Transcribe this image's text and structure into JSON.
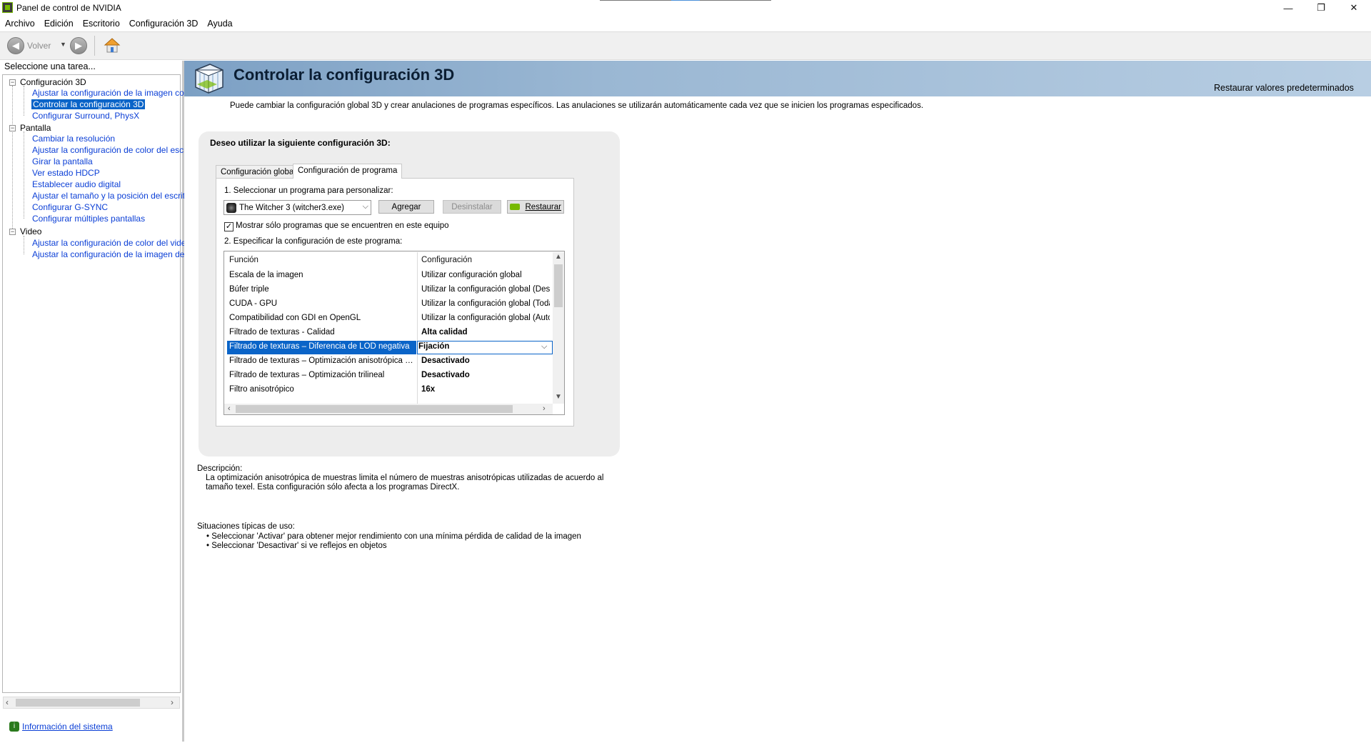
{
  "window": {
    "title": "Panel de control de NVIDIA",
    "controls": {
      "minimize": "—",
      "maximize": "❐",
      "close": "✕"
    }
  },
  "menu": [
    "Archivo",
    "Edición",
    "Escritorio",
    "Configuración 3D",
    "Ayuda"
  ],
  "toolbar": {
    "back_label": "Volver",
    "back_icon": "back-arrow-icon",
    "forward_icon": "forward-arrow-icon",
    "home_icon": "home-icon"
  },
  "sidebar": {
    "task_label": "Seleccione una tarea...",
    "categories": [
      {
        "label": "Configuración 3D",
        "items": [
          "Ajustar la configuración de la imagen con v",
          "Controlar la configuración 3D",
          "Configurar Surround, PhysX"
        ]
      },
      {
        "label": "Pantalla",
        "items": [
          "Cambiar la resolución",
          "Ajustar la configuración de color del escrito",
          "Girar la pantalla",
          "Ver estado HDCP",
          "Establecer audio digital",
          "Ajustar el tamaño y la posición del escritori",
          "Configurar G-SYNC",
          "Configurar múltiples pantallas"
        ]
      },
      {
        "label": "Video",
        "items": [
          "Ajustar la configuración de color del video",
          "Ajustar la configuración de la imagen de vic"
        ]
      }
    ],
    "selected_item": "Controlar la configuración 3D",
    "system_info": "Información del sistema"
  },
  "main": {
    "title": "Controlar la configuración 3D",
    "restore_defaults": "Restaurar valores predeterminados",
    "intro": "Puede cambiar la configuración global 3D y crear anulaciones de programas específicos. Las anulaciones se utilizarán automáticamente cada vez que se inicien los programas especificados.",
    "panel_heading": "Deseo utilizar la siguiente configuración 3D:",
    "tabs": [
      "Configuración global",
      "Configuración de programa"
    ],
    "active_tab": "Configuración de programa",
    "step1": "1. Seleccionar un programa para personalizar:",
    "program_selected": "The Witcher 3 (witcher3.exe)",
    "buttons": {
      "add": "Agregar",
      "uninstall": "Desinstalar",
      "restore": "Restaurar"
    },
    "checkbox_label": "Mostrar sólo programas que se encuentren en este equipo",
    "checkbox_checked": true,
    "step2": "2. Especificar la configuración de este programa:",
    "grid": {
      "headers": [
        "Función",
        "Configuración"
      ],
      "rows": [
        {
          "func": "Escala de la imagen",
          "value": "Utilizar configuración global",
          "bold": false
        },
        {
          "func": "Búfer triple",
          "value": "Utilizar la configuración global (Desact",
          "bold": false
        },
        {
          "func": "CUDA - GPU",
          "value": "Utilizar la configuración global (Todas)",
          "bold": false
        },
        {
          "func": "Compatibilidad con GDI en OpenGL",
          "value": "Utilizar la configuración global (Autom",
          "bold": false
        },
        {
          "func": "Filtrado de texturas - Calidad",
          "value": "Alta calidad",
          "bold": true
        },
        {
          "func": "Filtrado de texturas – Diferencia de LOD negativa",
          "value": "Fijación",
          "bold": true,
          "selected": true
        },
        {
          "func": "Filtrado de texturas – Optimización anisotrópica de...",
          "value": "Desactivado",
          "bold": true
        },
        {
          "func": "Filtrado de texturas – Optimización trilineal",
          "value": "Desactivado",
          "bold": true
        },
        {
          "func": "Filtro anisotrópico",
          "value": "16x",
          "bold": true
        }
      ]
    },
    "description_label": "Descripción:",
    "description_text": "La optimización anisotrópica de muestras limita el número de muestras anisotrópicas utilizadas de acuerdo al tamaño texel. Esta configuración sólo afecta a los programas DirectX.",
    "usage_label": "Situaciones típicas de uso:",
    "usage_items": [
      "Seleccionar 'Activar' para obtener mejor rendimiento con una mínima pérdida de calidad de la imagen",
      "Seleccionar 'Desactivar' si ve reflejos en objetos"
    ]
  },
  "colors": {
    "nvidia_green": "#76b900",
    "selection_blue": "#0a64c8",
    "link_blue": "#0b3fd6",
    "banner_blue": "#9ab7d3"
  }
}
